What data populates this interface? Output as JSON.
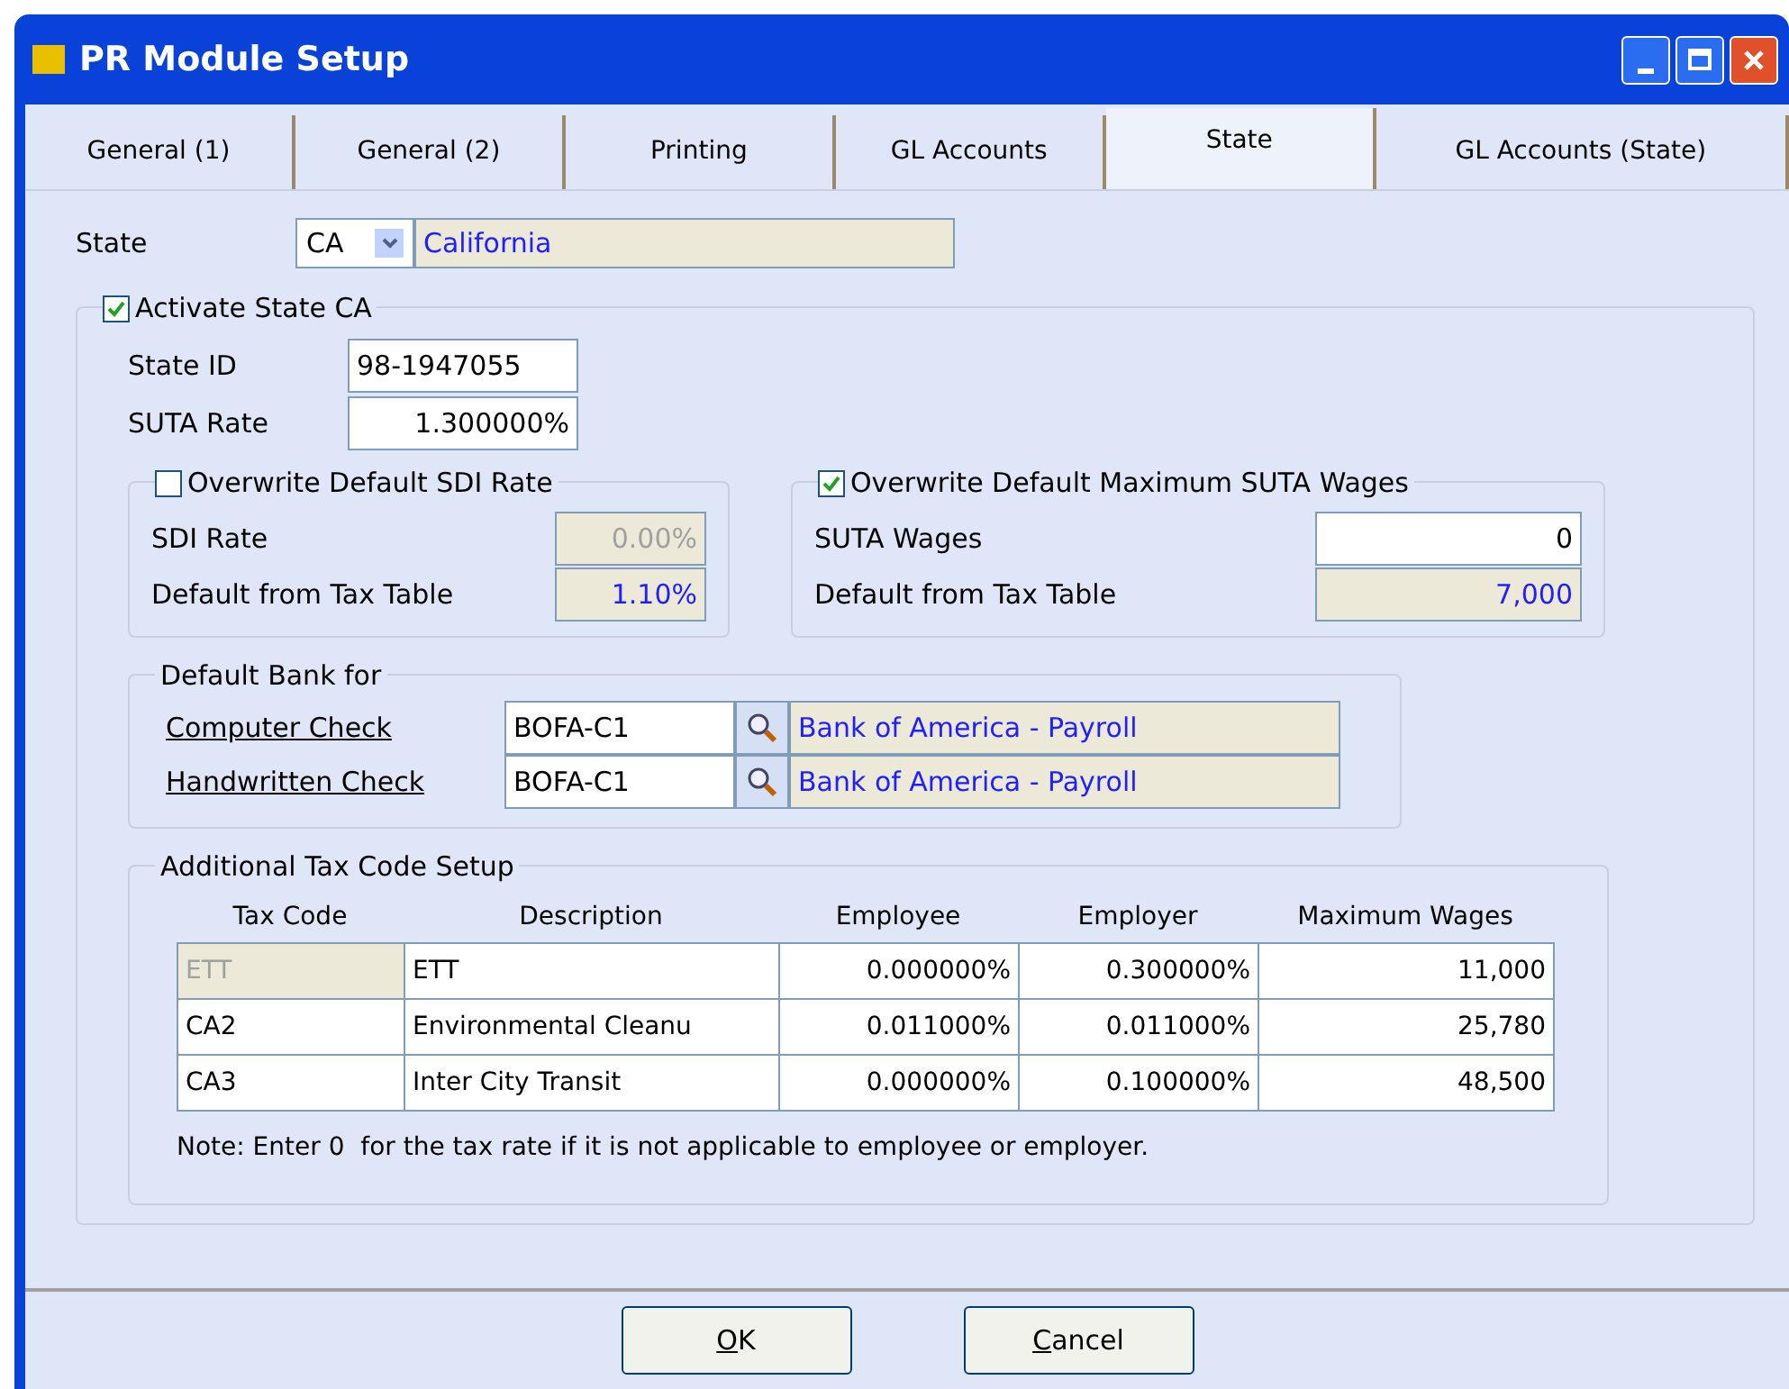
{
  "window": {
    "title": "PR Module Setup"
  },
  "tabs": [
    {
      "label": "General (1)",
      "selected": false
    },
    {
      "label": "General (2)",
      "selected": false
    },
    {
      "label": "Printing",
      "selected": false
    },
    {
      "label": "GL Accounts",
      "selected": false
    },
    {
      "label": "State",
      "selected": true
    },
    {
      "label": "GL Accounts (State)",
      "selected": false
    }
  ],
  "state": {
    "label": "State",
    "code": "CA",
    "name": "California"
  },
  "activate": {
    "label": "Activate State CA",
    "checked": true,
    "state_id": {
      "label": "State ID",
      "value": "98-1947055"
    },
    "suta_rate": {
      "label": "SUTA Rate",
      "value": "1.300000%"
    },
    "sdi_group": {
      "label": "Overwrite Default SDI Rate",
      "checked": false,
      "fields": [
        {
          "label": "SDI Rate",
          "value": "0.00%",
          "disabled": true,
          "blue": false
        },
        {
          "label": "Default from Tax Table",
          "value": "1.10%",
          "disabled": true,
          "blue": true
        }
      ]
    },
    "suta_group": {
      "label": "Overwrite Default Maximum SUTA Wages",
      "checked": true,
      "fields": [
        {
          "label": "SUTA Wages",
          "value": "0",
          "disabled": false,
          "blue": false
        },
        {
          "label": "Default from Tax Table",
          "value": "7,000",
          "disabled": true,
          "blue": true
        }
      ]
    },
    "bank_group": {
      "label": "Default Bank for",
      "rows": [
        {
          "label": "Computer Check",
          "code": "BOFA-C1",
          "name": "Bank of America - Payroll"
        },
        {
          "label": "Handwritten Check",
          "code": "BOFA-C1",
          "name": "Bank of America - Payroll"
        }
      ]
    },
    "tax_group": {
      "label": "Additional Tax Code Setup",
      "columns": [
        "Tax Code",
        "Description",
        "Employee",
        "Employer",
        "Maximum Wages"
      ],
      "rows": [
        {
          "cells": [
            "ETT",
            "ETT",
            "0.000000%",
            "0.300000%",
            "11,000"
          ],
          "disabled": true
        },
        {
          "cells": [
            "CA2",
            "Environmental Cleanu",
            "0.011000%",
            "0.011000%",
            "25,780"
          ],
          "disabled": false
        },
        {
          "cells": [
            "CA3",
            "Inter City Transit",
            "0.000000%",
            "0.100000%",
            "48,500"
          ],
          "disabled": false
        }
      ],
      "note": "Note: Enter 0  for the tax rate if it is not applicable to employee or employer."
    }
  },
  "buttons": [
    "OK",
    "Cancel"
  ]
}
